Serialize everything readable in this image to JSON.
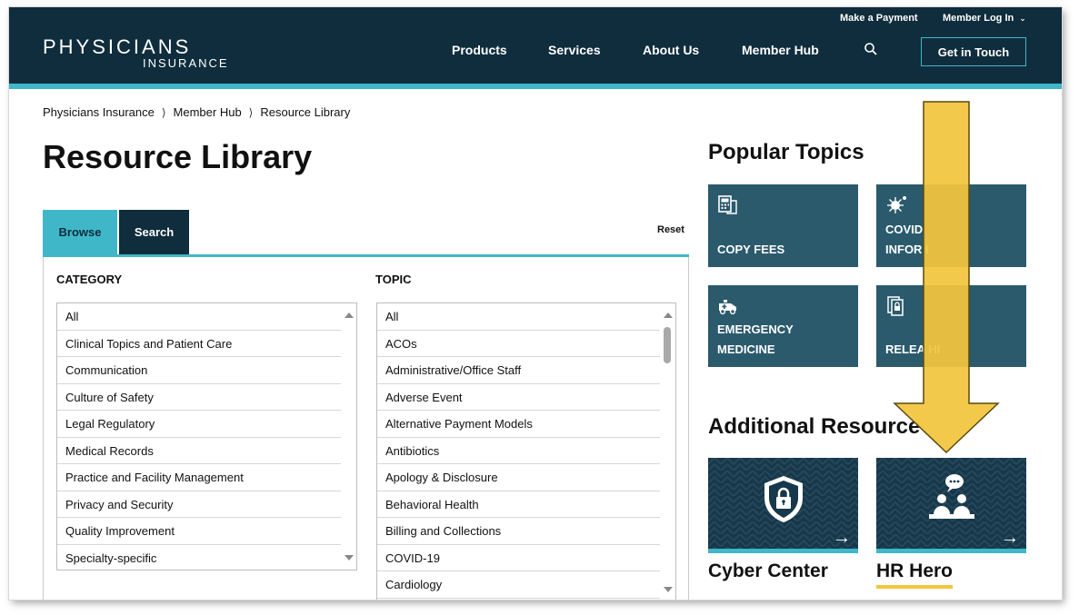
{
  "header": {
    "logo_main": "PHYSICIANS",
    "logo_sub": "INSURANCE",
    "utility": {
      "payment": "Make a Payment",
      "login": "Member Log In"
    },
    "nav": {
      "products": "Products",
      "services": "Services",
      "about": "About Us",
      "member_hub": "Member Hub"
    },
    "cta": "Get in Touch",
    "search_icon": "search-icon"
  },
  "breadcrumb": [
    "Physicians Insurance",
    "Member Hub",
    "Resource Library"
  ],
  "page_title": "Resource Library",
  "tabs": {
    "browse": "Browse",
    "search": "Search",
    "reset": "Reset"
  },
  "category": {
    "heading": "CATEGORY",
    "items": [
      "All",
      "Clinical Topics and Patient Care",
      "Communication",
      "Culture of Safety",
      "Legal Regulatory",
      "Medical Records",
      "Practice and Facility Management",
      "Privacy and Security",
      "Quality Improvement",
      "Specialty-specific"
    ]
  },
  "topic": {
    "heading": "TOPIC",
    "items": [
      "All",
      "ACOs",
      "Administrative/Office Staff",
      "Adverse Event",
      "Alternative Payment Models",
      "Antibiotics",
      "Apology & Disclosure",
      "Behavioral Health",
      "Billing and Collections",
      "COVID-19",
      "Cardiology"
    ]
  },
  "popular": {
    "title": "Popular Topics",
    "cards": [
      {
        "line1": "COPY FEES",
        "line2": "",
        "icon": "calculator-icon"
      },
      {
        "line1": "COVID",
        "line2": "INFOR     I",
        "icon": "virus-icon"
      },
      {
        "line1": "EMERGENCY",
        "line2": "MEDICINE",
        "icon": "ambulance-icon"
      },
      {
        "line1": "RELEA      HI",
        "line2": "",
        "icon": "locked-document-icon"
      }
    ]
  },
  "additional": {
    "title": "Additional Resource",
    "cards": [
      {
        "label": "Cyber Center",
        "icon": "shield-lock-icon"
      },
      {
        "label": "HR Hero",
        "icon": "people-chat-icon"
      }
    ]
  },
  "colors": {
    "navy": "#0f2d3c",
    "teal": "#3fb7c8",
    "card": "#2b5a6d",
    "highlight": "#f2c53d"
  }
}
